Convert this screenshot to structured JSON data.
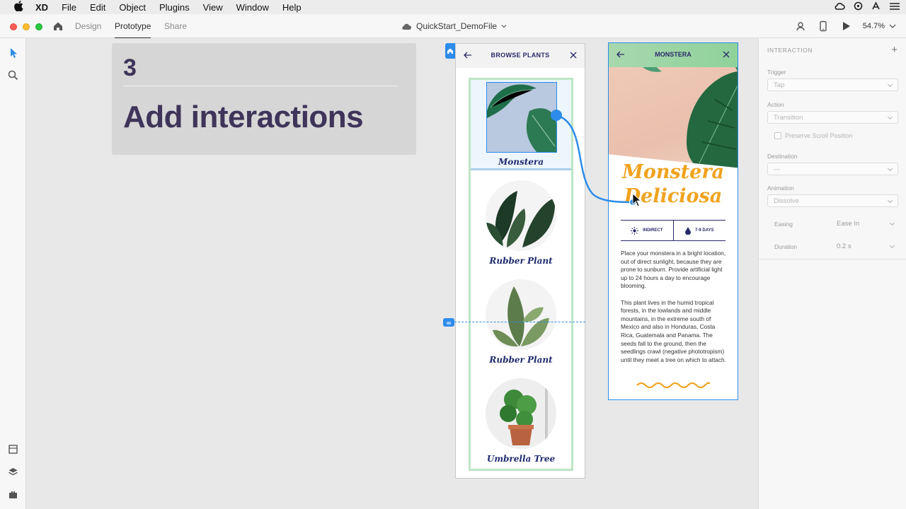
{
  "menubar": {
    "app_name": "XD",
    "items": [
      "File",
      "Edit",
      "Object",
      "Plugins",
      "View",
      "Window",
      "Help"
    ]
  },
  "titlebar": {
    "tabs": [
      "Design",
      "Prototype",
      "Share"
    ],
    "active_tab": "Prototype",
    "document_title": "QuickStart_DemoFile",
    "zoom": "54.7%"
  },
  "step_card": {
    "number": "3",
    "title": "Add interactions"
  },
  "artboard_browse": {
    "header_title": "BROWSE PLANTS",
    "plants": [
      "Monstera",
      "Rubber Plant",
      "Rubber Plant",
      "Umbrella Tree"
    ]
  },
  "artboard_detail": {
    "header_title": "MONSTERA",
    "heading_line1": "Monstera",
    "heading_line2": "Deliciosa",
    "badge_light": "INDIRECT",
    "badge_water": "7-9 DAYS",
    "paragraph1": "Place your monstera in a bright location, out of direct sunlight, because they are prone to sunburn. Provide artificial light up to 24 hours a day to encourage blooming.",
    "paragraph2": "This plant lives in the humid tropical forests, in the lowlands and middle mountains, in the extreme south of Mexico and also in Honduras, Costa Rica, Guatemala and Panama. The seeds fall to the ground, then the seedlings crawl (negative phototropism) until they meet a tree on which to attach."
  },
  "panel": {
    "title": "INTERACTION",
    "trigger_label": "Trigger",
    "trigger_value": "Tap",
    "action_label": "Action",
    "action_value": "Transition",
    "preserve_scroll": "Preserve Scroll Position",
    "destination_label": "Destination",
    "destination_value": "—",
    "animation_label": "Animation",
    "animation_value": "Dissolve",
    "easing_label": "Easing",
    "easing_value": "Ease In",
    "duration_label": "Duration",
    "duration_value": "0.2 s"
  },
  "colors": {
    "accent": "#2d8ceb",
    "heading_purple": "#3f3459",
    "plant_title_navy": "#1e2a6e",
    "detail_orange": "#f0a31e"
  }
}
